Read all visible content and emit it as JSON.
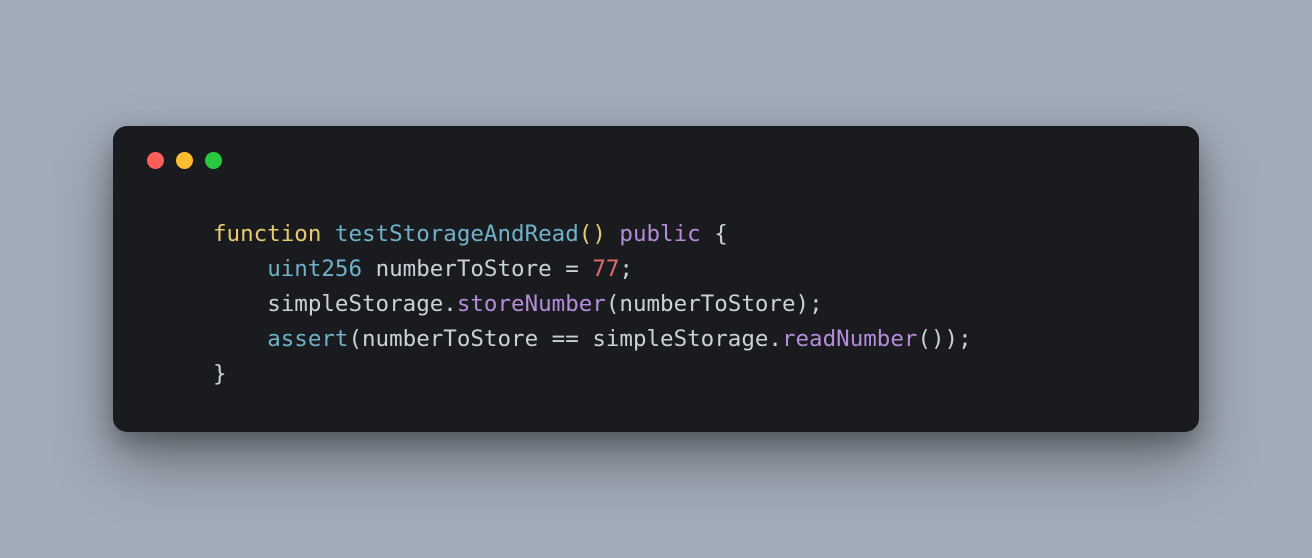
{
  "window": {
    "traffic_lights": [
      "red",
      "yellow",
      "green"
    ]
  },
  "code": {
    "indent1": "    ",
    "indent2": "        ",
    "line1": {
      "kw_function": "function",
      "space": " ",
      "funcname": "testStorageAndRead",
      "paren_open": "(",
      "paren_close": ")",
      "space2": " ",
      "visibility": "public",
      "space3": " ",
      "brace_open": "{"
    },
    "line2": {
      "type": "uint256",
      "space": " ",
      "ident": "numberToStore",
      "space2": " ",
      "eq": "=",
      "space3": " ",
      "number": "77",
      "semi": ";"
    },
    "line3": {
      "obj": "simpleStorage",
      "dot": ".",
      "method": "storeNumber",
      "paren_open": "(",
      "arg": "numberToStore",
      "paren_close": ")",
      "semi": ";"
    },
    "line4": {
      "assert": "assert",
      "paren_open": "(",
      "lhs": "numberToStore",
      "space": " ",
      "eqeq": "==",
      "space2": " ",
      "obj": "simpleStorage",
      "dot": ".",
      "method": "readNumber",
      "paren_open2": "(",
      "paren_close2": ")",
      "paren_close": ")",
      "semi": ";"
    },
    "line5": {
      "brace_close": "}"
    }
  }
}
